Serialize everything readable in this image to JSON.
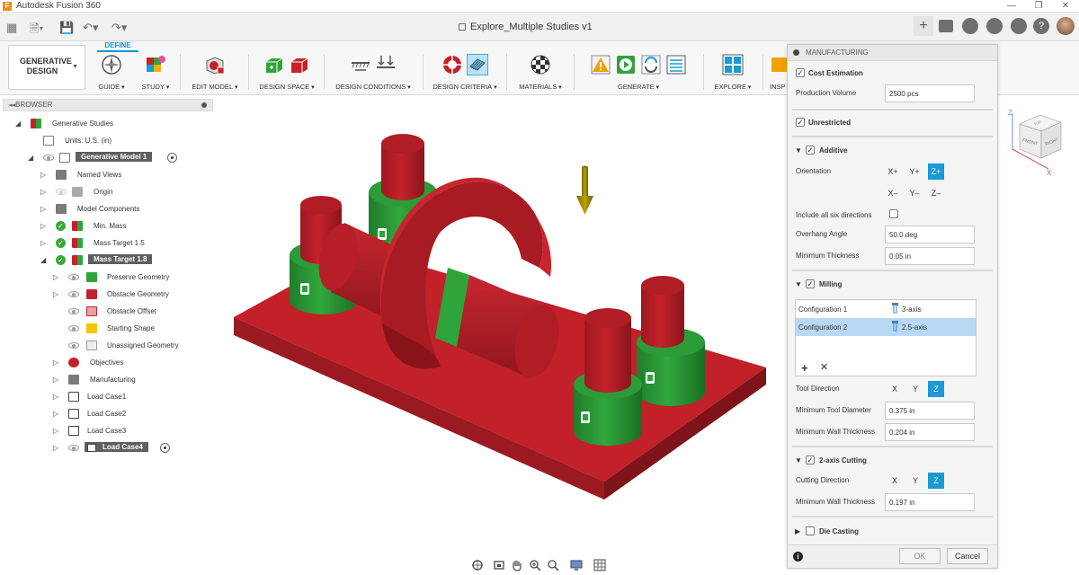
{
  "app": {
    "title": "Autodesk Fusion 360",
    "logo_letter": "F"
  },
  "document": {
    "title": "Explore_Multiple Studies v1"
  },
  "toolbar": {
    "workspace_label": "GENERATIVE DESIGN",
    "active_tab": "DEFINE",
    "groups": [
      {
        "label": "GUIDE"
      },
      {
        "label": "STUDY"
      },
      {
        "label": "EDIT MODEL"
      },
      {
        "label": "DESIGN SPACE"
      },
      {
        "label": "DESIGN CONDITIONS"
      },
      {
        "label": "DESIGN CRITERIA"
      },
      {
        "label": "MATERIALS"
      },
      {
        "label": "GENERATE"
      },
      {
        "label": "EXPLORE"
      },
      {
        "label": "INSP"
      }
    ]
  },
  "browser": {
    "title": "BROWSER",
    "items": [
      {
        "label": "Generative Studies"
      },
      {
        "label": "Units: U.S. (in)"
      },
      {
        "label": "Generative Model 1"
      },
      {
        "label": "Named Views"
      },
      {
        "label": "Origin"
      },
      {
        "label": "Model Components"
      },
      {
        "label": "Min. Mass"
      },
      {
        "label": "Mass Target 1.5"
      },
      {
        "label": "Mass Target 1.8"
      },
      {
        "label": "Preserve Geometry"
      },
      {
        "label": "Obstacle Geometry"
      },
      {
        "label": "Obstacle Offset"
      },
      {
        "label": "Starting Shape"
      },
      {
        "label": "Unassigned Geometry"
      },
      {
        "label": "Objectives"
      },
      {
        "label": "Manufacturing"
      },
      {
        "label": "Load Case1"
      },
      {
        "label": "Load Case2"
      },
      {
        "label": "Load Case3"
      },
      {
        "label": "Load Case4"
      }
    ]
  },
  "manufacturing": {
    "title": "MANUFACTURING",
    "cost_estimation": {
      "label": "Cost Estimation",
      "checked": true
    },
    "production_volume": {
      "label": "Production Volume",
      "value": "2500 pcs"
    },
    "unrestricted": {
      "label": "Unrestricted",
      "checked": true
    },
    "additive": {
      "label": "Additive",
      "checked": true,
      "orientation_label": "Orientation",
      "orient_pos": [
        "X+",
        "Y+",
        "Z+"
      ],
      "orient_neg": [
        "X–",
        "Y–",
        "Z–"
      ],
      "selected_orientation": "Z+",
      "six_dir_label": "Include all six directions",
      "overhang_label": "Overhang Angle",
      "overhang_value": "50.0 deg",
      "min_thickness_label": "Minimum Thickness",
      "min_thickness_value": "0.05 in"
    },
    "milling": {
      "label": "Milling",
      "checked": true,
      "configurations": [
        {
          "name": "Configuration 1",
          "type": "3-axis"
        },
        {
          "name": "Configuration 2",
          "type": "2.5-axis"
        }
      ],
      "tool_direction_label": "Tool Direction",
      "axes": [
        "X",
        "Y",
        "Z"
      ],
      "selected_axis": "Z",
      "min_tool_diameter_label": "Minimum Tool Diameter",
      "min_tool_diameter_value": "0.375 in",
      "min_wall_label": "Minimum Wall Thickness",
      "min_wall_value": "0.204 in"
    },
    "two_axis": {
      "label": "2-axis Cutting",
      "checked": true,
      "cutting_direction_label": "Cutting Direction",
      "axes": [
        "X",
        "Y",
        "Z"
      ],
      "selected_axis": "Z",
      "min_wall_label": "Minimum Wall Thickness",
      "min_wall_value": "0.197 in"
    },
    "die_casting": {
      "label": "Die Casting",
      "checked": false
    },
    "ok_label": "OK",
    "cancel_label": "Cancel",
    "info_label": "i"
  },
  "viewcube": {
    "top": "TOP",
    "front": "FRONT",
    "right": "RIGHT",
    "x_axis": "X",
    "z_axis": "Z"
  },
  "colors": {
    "accent": "#0696d7",
    "obstacle_red": "#c4222b",
    "preserve_green": "#2ea43a",
    "selection_blue": "#b8d8f5",
    "check_green": "#3aa93a"
  }
}
